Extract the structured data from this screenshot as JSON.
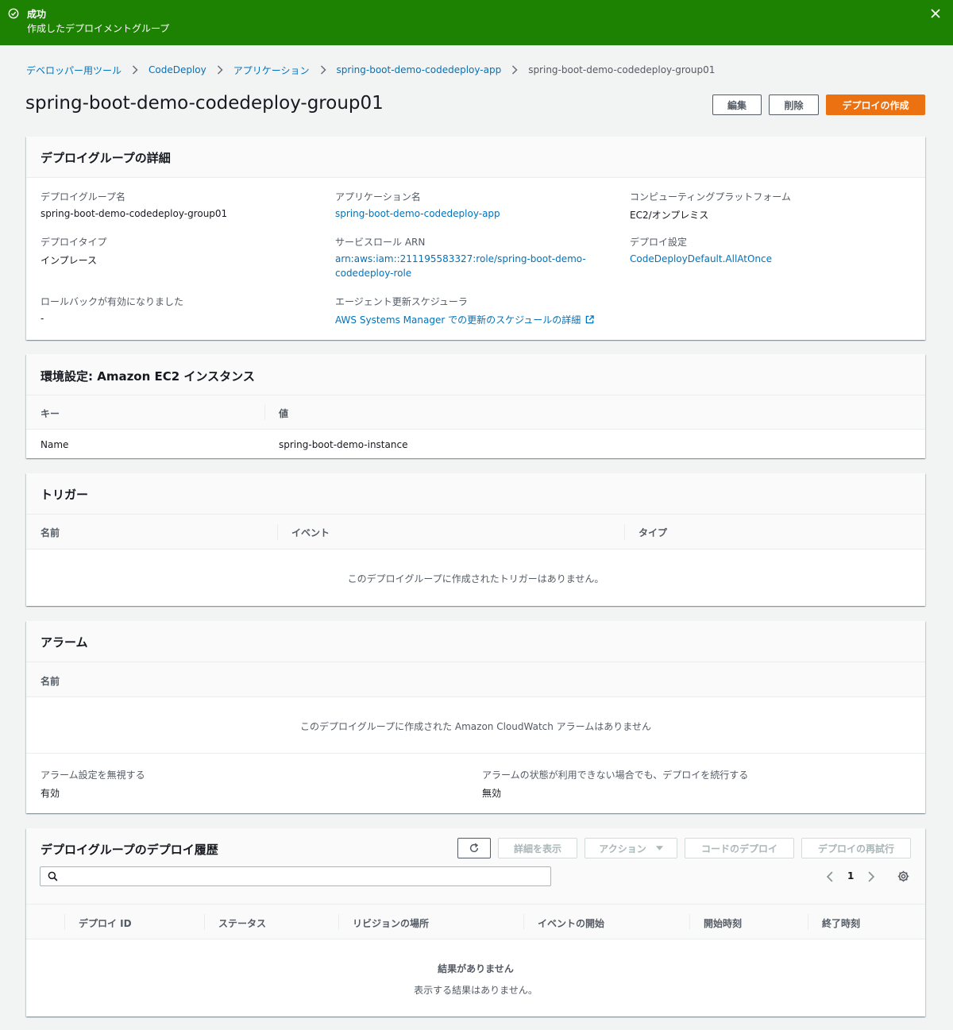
{
  "flash": {
    "title": "成功",
    "message": "作成したデプロイメントグループ"
  },
  "breadcrumb": [
    "デベロッパー用ツール",
    "CodeDeploy",
    "アプリケーション",
    "spring-boot-demo-codedeploy-app",
    "spring-boot-demo-codedeploy-group01"
  ],
  "page": {
    "title": "spring-boot-demo-codedeploy-group01",
    "edit_label": "編集",
    "delete_label": "削除",
    "create_deploy_label": "デプロイの作成"
  },
  "details": {
    "heading": "デプロイグループの詳細",
    "group_name_label": "デプロイグループ名",
    "group_name": "spring-boot-demo-codedeploy-group01",
    "app_name_label": "アプリケーション名",
    "app_name": "spring-boot-demo-codedeploy-app",
    "platform_label": "コンピューティングプラットフォーム",
    "platform": "EC2/オンプレミス",
    "deploy_type_label": "デプロイタイプ",
    "deploy_type": "インプレース",
    "role_arn_label": "サービスロール ARN",
    "role_arn_line1": "arn:aws:iam::211195583327:role/spring-boot-demo-",
    "role_arn_line2": "codedeploy-role",
    "deploy_config_label": "デプロイ設定",
    "deploy_config": "CodeDeployDefault.AllAtOnce",
    "rollback_label": "ロールバックが有効になりました",
    "rollback": "-",
    "agent_label": "エージェント更新スケジューラ",
    "agent_link": "AWS Systems Manager での更新のスケジュールの詳細"
  },
  "env": {
    "heading": "環境設定: Amazon EC2 インスタンス",
    "columns": [
      "キー",
      "値"
    ],
    "rows": [
      [
        "Name",
        "spring-boot-demo-instance"
      ]
    ]
  },
  "triggers": {
    "heading": "トリガー",
    "columns": [
      "名前",
      "イベント",
      "タイプ"
    ],
    "empty": "このデプロイグループに作成されたトリガーはありません。"
  },
  "alarms": {
    "heading": "アラーム",
    "columns": [
      "名前"
    ],
    "empty": "このデプロイグループに作成された Amazon CloudWatch アラームはありません",
    "ignore_label": "アラーム設定を無視する",
    "ignore_value": "有効",
    "continue_label": "アラームの状態が利用できない場合でも、デプロイを続行する",
    "continue_value": "無効"
  },
  "history": {
    "heading": "デプロイグループのデプロイ履歴",
    "view_details_label": "詳細を表示",
    "actions_label": "アクション",
    "code_deploy_label": "コードのデプロイ",
    "retry_label": "デプロイの再試行",
    "search_placeholder": "",
    "page_number": "1",
    "columns": [
      "デプロイ ID",
      "ステータス",
      "リビジョンの場所",
      "イベントの開始",
      "開始時刻",
      "終了時刻"
    ],
    "empty_title": "結果がありません",
    "empty_message": "表示する結果はありません。"
  },
  "colors": {
    "success": "#1d8102",
    "primary": "#ec7211",
    "link": "#0073bb"
  }
}
